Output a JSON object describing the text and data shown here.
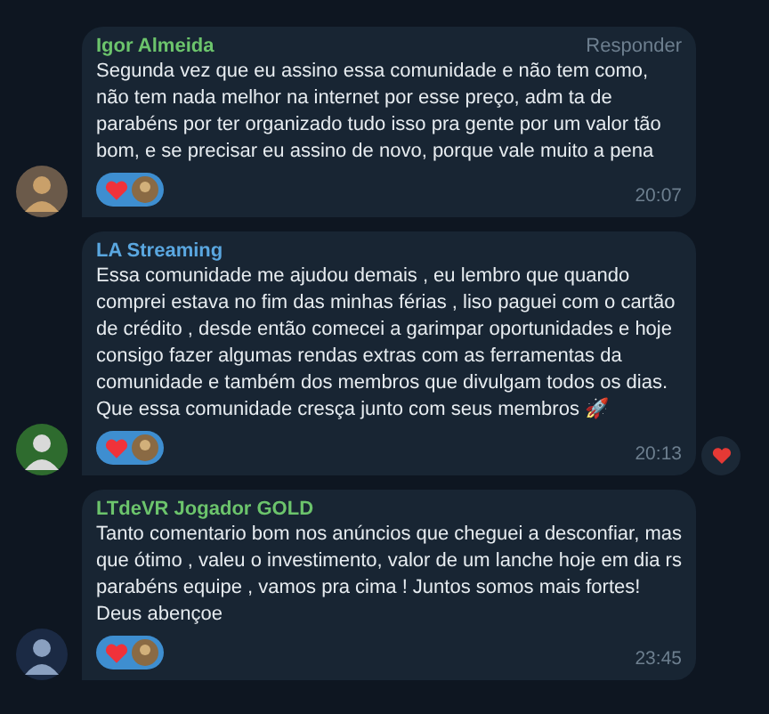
{
  "messages": [
    {
      "author": "Igor Almeida",
      "color": "#6cc46c",
      "reply_label": "Responder",
      "text": "Segunda vez que eu assino essa comunidade e não tem como, não tem nada melhor na internet por esse preço, adm ta de parabéns por ter organizado tudo isso pra gente por um valor tão bom, e se precisar eu assino de novo, porque vale muito a pena",
      "time": "20:07",
      "quick_reaction": false
    },
    {
      "author": "LA Streaming",
      "color": "#5aa7e0",
      "text": "Essa comunidade me ajudou demais , eu lembro que quando comprei estava no fim das minhas férias , liso paguei com o cartão de crédito , desde então comecei a garimpar oportunidades e hoje consigo fazer algumas rendas extras com as ferramentas da comunidade e também dos membros que divulgam todos os dias. Que essa comunidade cresça junto com seus membros 🚀",
      "time": "20:13",
      "quick_reaction": true
    },
    {
      "author": "LTdeVR Jogador GOLD",
      "color": "#6cc46c",
      "text": "Tanto comentario bom nos anúncios que cheguei a desconfiar, mas que ótimo , valeu o investimento, valor de um lanche hoje em dia rs parabéns equipe , vamos pra cima ! Juntos somos mais fortes! Deus abençoe",
      "time": "23:45",
      "quick_reaction": false
    }
  ]
}
